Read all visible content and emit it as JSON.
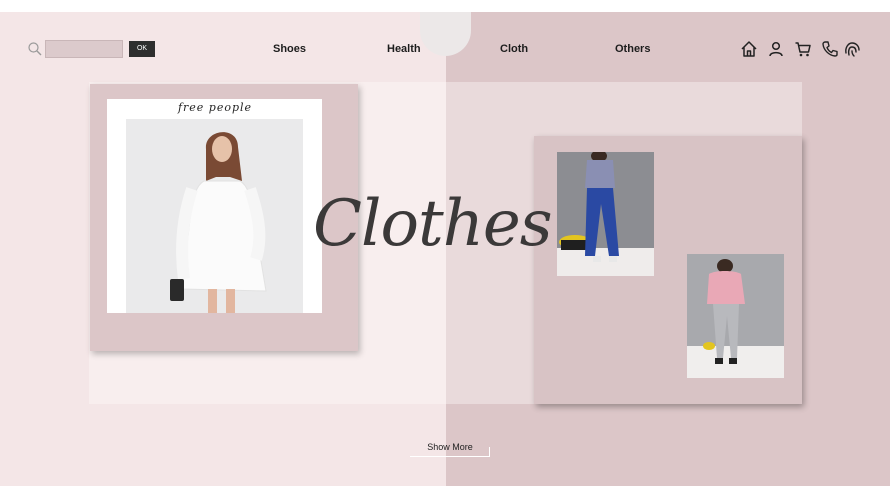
{
  "search": {
    "placeholder": "",
    "value": "",
    "button_label": "OK"
  },
  "nav": [
    {
      "label": "Shoes"
    },
    {
      "label": "Health"
    },
    {
      "label": "Cloth"
    },
    {
      "label": "Others"
    }
  ],
  "header_icons": [
    "home-icon",
    "user-icon",
    "cart-icon",
    "phone-icon",
    "fingerprint-icon"
  ],
  "hero": {
    "title": "Clothes",
    "brand": "free people"
  },
  "actions": {
    "show_more": "Show More"
  },
  "colors": {
    "left_bg": "#f4e6e7",
    "right_bg": "#dcc6c8",
    "card": "#dcc6c8",
    "button_dark": "#2e2e2e",
    "title": "#3b3939"
  }
}
